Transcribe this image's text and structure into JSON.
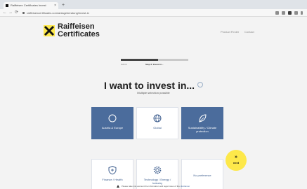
{
  "browser": {
    "tab_title": "Raiffeisen Certificates Invest",
    "tab_close": "×",
    "new_tab": "+",
    "url": "raiffeisencertificates.com/anlageberatung/invest-in",
    "nav": {
      "back": "←",
      "forward": "→",
      "reload": "⟳"
    }
  },
  "header": {
    "logo_line1": "Raiffeisen",
    "logo_line2": "Certificates",
    "links": [
      "Product Finder",
      "Contact"
    ],
    "brand_yellow": "#fde84a"
  },
  "progress": {
    "fraction": 0.55,
    "step_a": "Schritt",
    "step_b": "Step 3: Invest in..."
  },
  "main": {
    "title": "I want to invest in...",
    "subtitle": "Multiple selection possible"
  },
  "tiles": [
    {
      "label": "Austria & Europe",
      "icon": "circle-icon",
      "selected": true
    },
    {
      "label": "Global",
      "icon": "globe-icon",
      "selected": false
    },
    {
      "label": "Sustainability / Climate protection",
      "icon": "leaf-icon",
      "selected": true
    },
    {
      "label": "Finance / Health",
      "icon": "shield-icon",
      "selected": false
    },
    {
      "label": "Technology / Energy / Industry",
      "icon": "gear-icon",
      "selected": false
    },
    {
      "label": "No preference",
      "icon": "",
      "selected": false
    }
  ],
  "next_button": {
    "arrows": "»",
    "label": "next"
  },
  "footer": {
    "text": "Please take into account the information and legal notes of the",
    "link": "disclaimer"
  },
  "colors": {
    "selected_tile": "#4b6c9c",
    "accent": "#4b6c9c"
  }
}
